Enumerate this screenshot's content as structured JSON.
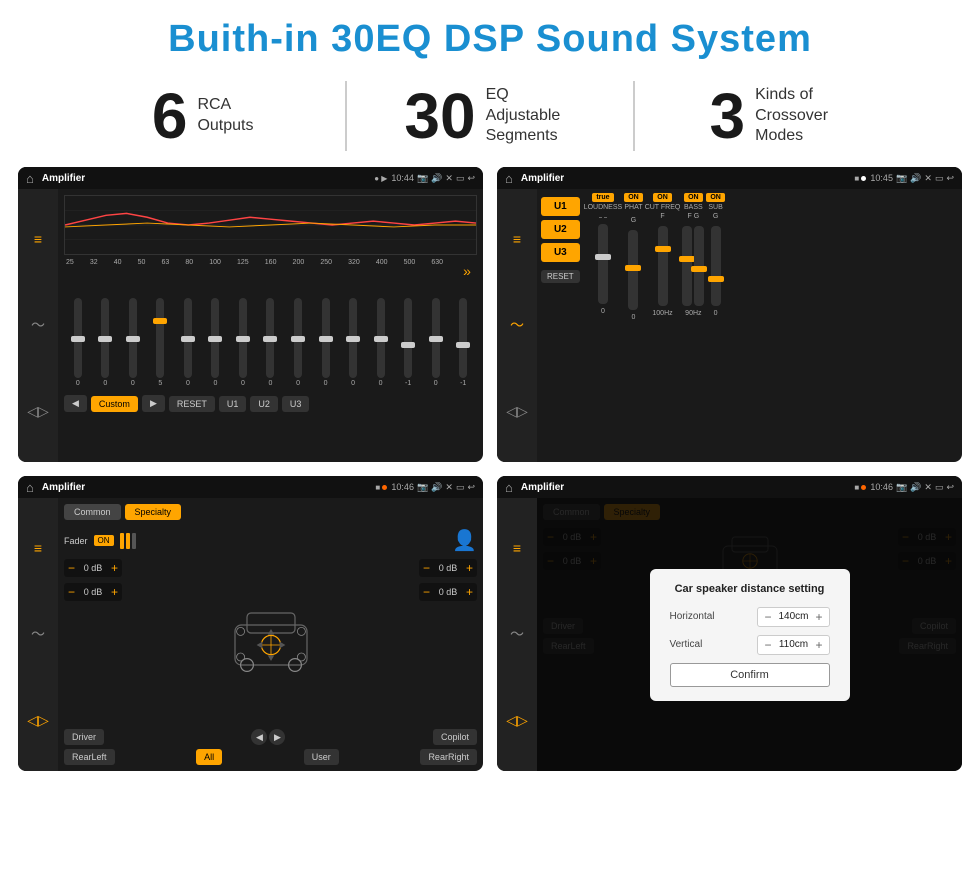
{
  "title": "Buith-in 30EQ DSP Sound System",
  "stats": [
    {
      "number": "6",
      "label": "RCA\nOutputs"
    },
    {
      "number": "30",
      "label": "EQ Adjustable\nSegments"
    },
    {
      "number": "3",
      "label": "Kinds of\nCrossover Modes"
    }
  ],
  "screens": [
    {
      "id": "screen1",
      "statusBar": {
        "time": "10:44",
        "title": "Amplifier"
      },
      "freqLabels": [
        "25",
        "32",
        "40",
        "50",
        "63",
        "80",
        "100",
        "125",
        "160",
        "200",
        "250",
        "320",
        "400",
        "500",
        "630"
      ],
      "sliderValues": [
        "0",
        "0",
        "0",
        "5",
        "0",
        "0",
        "0",
        "0",
        "0",
        "0",
        "0",
        "0",
        "-1",
        "0",
        "-1"
      ],
      "bottomBtns": [
        "Custom",
        "RESET",
        "U1",
        "U2",
        "U3"
      ]
    },
    {
      "id": "screen2",
      "statusBar": {
        "time": "10:45",
        "title": "Amplifier"
      },
      "uButtons": [
        "U1",
        "U2",
        "U3"
      ],
      "channels": [
        {
          "label": "LOUDNESS",
          "on": true
        },
        {
          "label": "PHAT",
          "on": true
        },
        {
          "label": "CUT FREQ",
          "on": true
        },
        {
          "label": "BASS",
          "on": true
        },
        {
          "label": "SUB",
          "on": true
        }
      ]
    },
    {
      "id": "screen3",
      "statusBar": {
        "time": "10:46",
        "title": "Amplifier"
      },
      "tabs": [
        "Common",
        "Specialty"
      ],
      "activeTab": "Specialty",
      "fader": {
        "label": "Fader",
        "on": true
      },
      "dbValues": [
        "0 dB",
        "0 dB",
        "0 dB",
        "0 dB"
      ],
      "bottomBtns": [
        "Driver",
        "",
        "Copilot",
        "RearLeft",
        "All",
        "User",
        "RearRight"
      ]
    },
    {
      "id": "screen4",
      "statusBar": {
        "time": "10:46",
        "title": "Amplifier"
      },
      "tabs": [
        "Common",
        "Specialty"
      ],
      "dialog": {
        "title": "Car speaker distance setting",
        "horizontal": {
          "label": "Horizontal",
          "value": "140cm"
        },
        "vertical": {
          "label": "Vertical",
          "value": "110cm"
        },
        "confirmBtn": "Confirm"
      },
      "dbValues": [
        "0 dB",
        "0 dB"
      ],
      "bottomBtns": [
        "Driver",
        "Copilot",
        "RearLeft",
        "User",
        "RearRight"
      ]
    }
  ]
}
